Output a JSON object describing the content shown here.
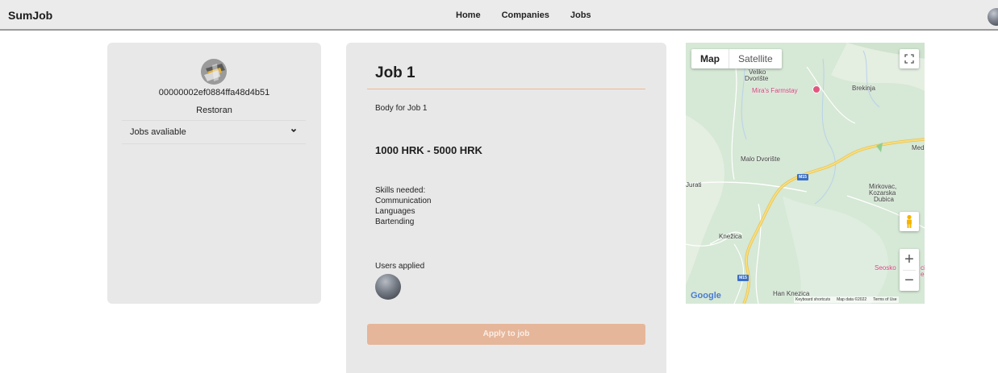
{
  "navbar": {
    "brand": "SumJob",
    "links": [
      "Home",
      "Companies",
      "Jobs"
    ]
  },
  "company": {
    "id": "00000002ef0884ffa48d4b51",
    "type": "Restoran",
    "jobs_dropdown_label": "Jobs avaliable"
  },
  "job": {
    "title": "Job 1",
    "body": "Body for Job 1",
    "salary": "1000 HRK - 5000 HRK",
    "skills_heading": "Skills needed:",
    "skills": [
      "Communication",
      "Languages",
      "Bartending"
    ],
    "users_applied_label": "Users applied",
    "apply_button": "Apply to job"
  },
  "map": {
    "type_map": "Map",
    "type_satellite": "Satellite",
    "places": {
      "veliko": "Veliko",
      "dvoriste": "Dvorište",
      "farmstay": "Mira's Farmstay",
      "brekinja": "Brekinja",
      "med": "Med",
      "malo": "Malo Dvorište",
      "jurati": "Jurati",
      "mirkovac1": "Mirkovac,",
      "mirkovac2": "Kozarska",
      "mirkovac3": "Dubica",
      "knezica": "Knežica",
      "seosko": "Seosko",
      "seosko_tail1": "ci",
      "seosko_tail2": "ec",
      "han": "Han Knezica"
    },
    "road": "M15",
    "google": "Google",
    "footer": {
      "shortcuts": "Keyboard shortcuts",
      "data": "Map data ©2022",
      "terms": "Terms of Use"
    },
    "zoom_in": "+",
    "zoom_out": "−"
  },
  "colors": {
    "accent": "#f0b98e",
    "apply_button": "#e6b69a",
    "card": "#e8e8e8",
    "navbar": "#ebebeb"
  }
}
